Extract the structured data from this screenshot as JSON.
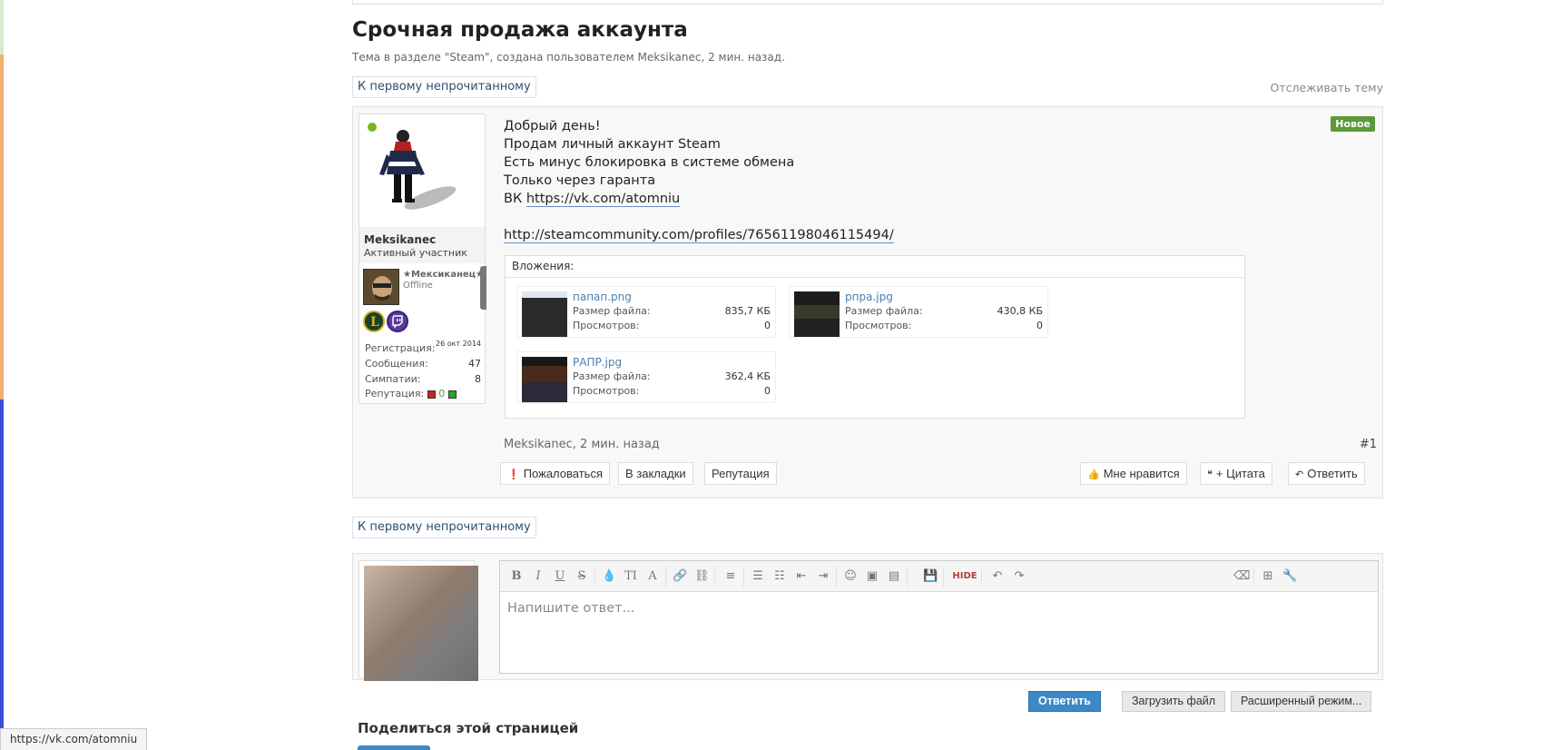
{
  "thread": {
    "title": "Срочная продажа аккаунта",
    "description": "Тема в разделе \"Steam\", создана пользователем Meksikanec, 2 мин. назад.",
    "first_unread": "К первому непрочитанному",
    "watch": "Отслеживать тему"
  },
  "post": {
    "author": "Meksikanec",
    "author_title": "Активный участник",
    "steam_name": "★Мексиканец★",
    "steam_status": "Offline",
    "stats": {
      "reg_label": "Регистрация:",
      "reg_value": "26 окт 2014",
      "msgs_label": "Сообщения:",
      "msgs_value": "47",
      "likes_label": "Симпатии:",
      "likes_value": "8",
      "rep_label": "Репутация:",
      "rep_value": "0"
    },
    "badge_new": "Новое",
    "lines": [
      "Добрый день!",
      "Продам личный аккаунт Steam",
      "Есть минус блокировка в системе обмена",
      "Только через гаранта"
    ],
    "vk_prefix": "ВК",
    "vk_link": "https://vk.com/atomniu",
    "steam_link": "http://steamcommunity.com/profiles/76561198046115494/",
    "attachments_label": "Вложения:",
    "attachments": [
      {
        "name": "папап.png",
        "size_label": "Размер файла:",
        "size": "835,7 КБ",
        "views_label": "Просмотров:",
        "views": "0"
      },
      {
        "name": "рпра.jpg",
        "size_label": "Размер файла:",
        "size": "430,8 КБ",
        "views_label": "Просмотров:",
        "views": "0"
      },
      {
        "name": "РАПР.jpg",
        "size_label": "Размер файла:",
        "size": "362,4 КБ",
        "views_label": "Просмотров:",
        "views": "0"
      }
    ],
    "meta": "Meksikanec, 2 мин. назад",
    "number": "#1",
    "actions": {
      "report": "Пожаловаться",
      "bookmark": "В закладки",
      "reputation": "Репутация",
      "like": "Мне нравится",
      "quote": "+ Цитата",
      "reply": "Ответить"
    }
  },
  "reply": {
    "placeholder": "Напишите ответ...",
    "submit": "Ответить",
    "upload": "Загрузить файл",
    "advanced": "Расширенный режим..."
  },
  "share": {
    "title": "Поделиться этой страницей"
  },
  "statusbar": {
    "url": "https://vk.com/atomniu"
  },
  "colors": {
    "accent": "#3d88c8",
    "online": "#7cb21f",
    "new_badge": "#5b9a3b"
  }
}
